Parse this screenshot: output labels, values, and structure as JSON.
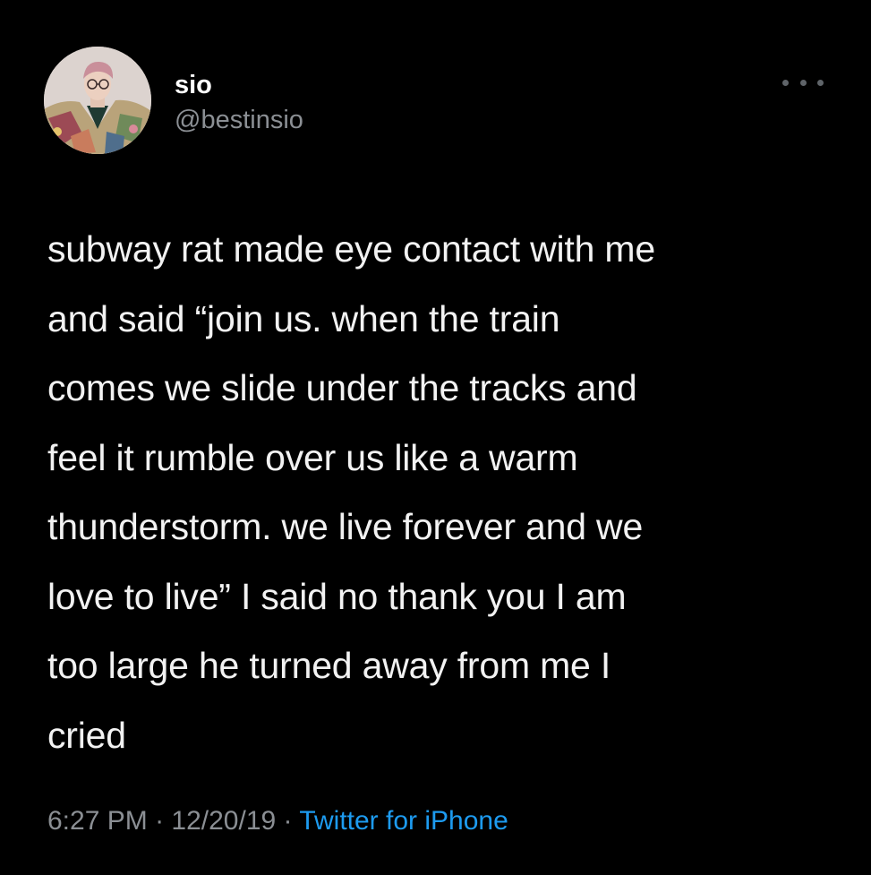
{
  "user": {
    "display_name": "sio",
    "handle": "@bestinsio",
    "avatar_icon": "profile-photo"
  },
  "more_menu_icon": "ellipsis-icon",
  "tweet": {
    "text": "subway rat made eye contact with me\nand said “join us. when the train\ncomes we slide under the tracks and\nfeel it rumble over us like a warm\nthunderstorm. we live forever and we\nlove to live” I said no thank you I am\ntoo large he turned away from me I\ncried"
  },
  "meta": {
    "time": "6:27 PM",
    "separator": " · ",
    "date": "12/20/19",
    "source": "Twitter for iPhone"
  },
  "colors": {
    "background": "#000000",
    "text": "#f2f2f2",
    "secondary": "#8b8f94",
    "accent": "#1d9bf0"
  }
}
